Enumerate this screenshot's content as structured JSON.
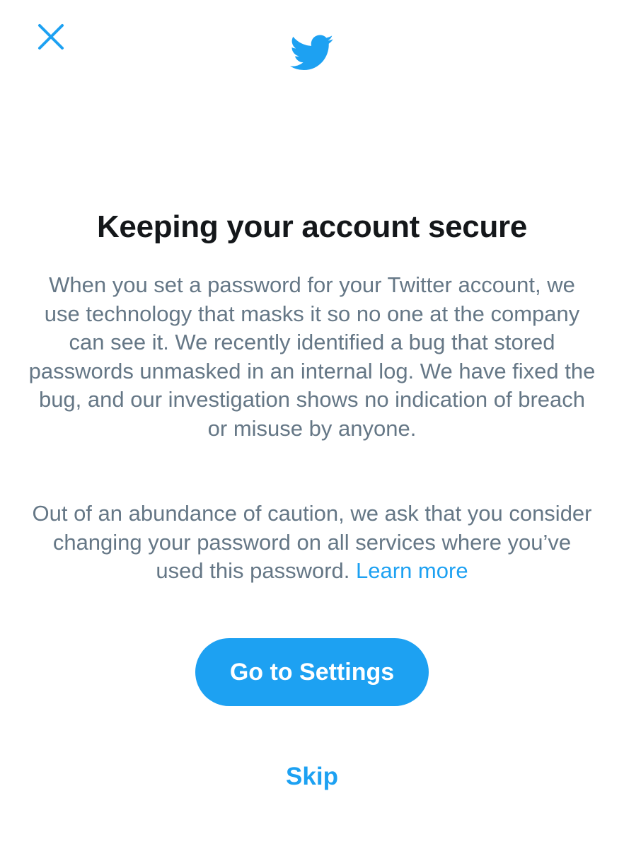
{
  "header": {
    "close_icon": "close-icon",
    "logo_icon": "twitter-bird-icon"
  },
  "dialog": {
    "title": "Keeping your account secure",
    "paragraph1": "When you set a password for your Twitter account, we use technology that masks it so no one at the company can see it. We recently identified a bug that stored passwords unmasked in an internal log. We have fixed the bug, and our investigation shows no indication of breach or misuse by anyone.",
    "paragraph2": "Out of an abundance of caution, we ask that you consider changing your password on all services where you’ve used this password.",
    "learn_more_label": "Learn more",
    "primary_button_label": "Go to Settings",
    "skip_label": "Skip"
  },
  "colors": {
    "accent": "#1da1f2",
    "title_text": "#14171a",
    "body_text": "#657786",
    "background": "#ffffff"
  }
}
